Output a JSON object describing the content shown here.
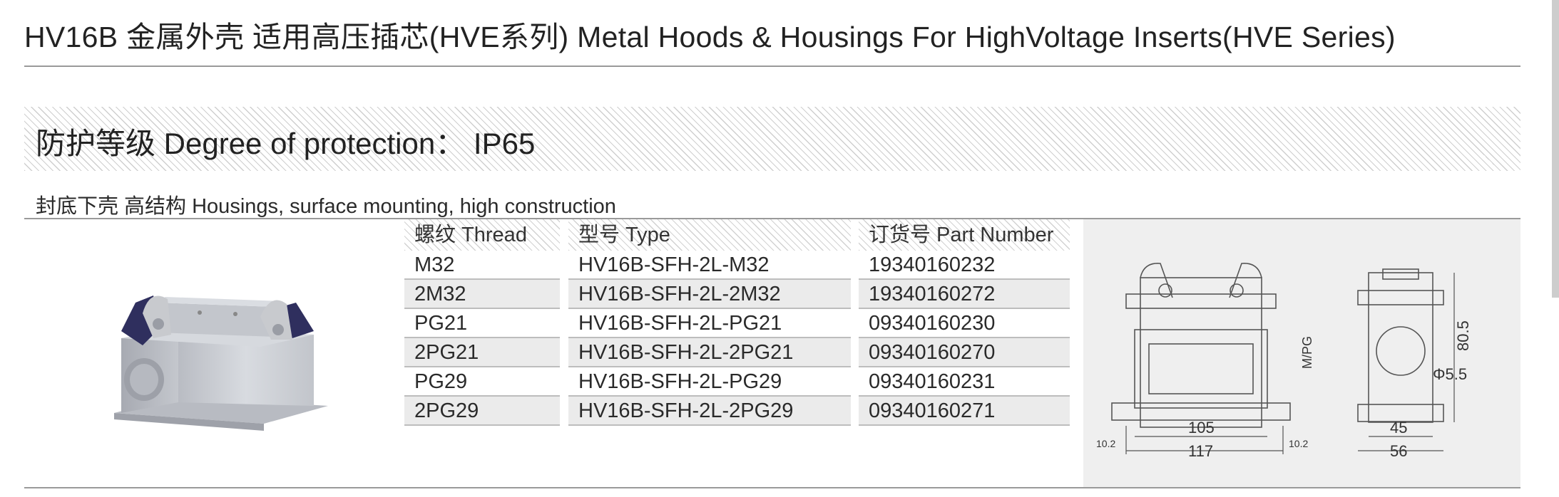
{
  "header": {
    "title": "HV16B 金属外壳  适用高压插芯(HVE系列)  Metal Hoods & Housings For HighVoltage Inserts(HVE Series)"
  },
  "protection": {
    "text": "防护等级 Degree of protection： IP65"
  },
  "section": {
    "subtitle": "封底下壳 高结构 Housings, surface mounting, high construction"
  },
  "table": {
    "columns": [
      "螺纹 Thread",
      "型号 Type",
      "订货号 Part Number"
    ],
    "rows": [
      {
        "thread": "M32",
        "type": "HV16B-SFH-2L-M32",
        "part_number": "19340160232"
      },
      {
        "thread": "2M32",
        "type": "HV16B-SFH-2L-2M32",
        "part_number": "19340160272"
      },
      {
        "thread": "PG21",
        "type": "HV16B-SFH-2L-PG21",
        "part_number": "09340160230"
      },
      {
        "thread": "2PG21",
        "type": "HV16B-SFH-2L-2PG21",
        "part_number": "09340160270"
      },
      {
        "thread": "PG29",
        "type": "HV16B-SFH-2L-PG29",
        "part_number": "09340160231"
      },
      {
        "thread": "2PG29",
        "type": "HV16B-SFH-2L-2PG29",
        "part_number": "09340160271"
      }
    ]
  },
  "drawing": {
    "front": {
      "dim_inner": "105",
      "dim_outer": "117",
      "edge_left": "10.2",
      "edge_right": "10.2",
      "thread_label": "M/PG"
    },
    "side": {
      "dim_inner": "45",
      "dim_outer": "56",
      "height": "80.5",
      "hole": "Φ5.5"
    }
  },
  "colors": {
    "housing": "#c9ccd2",
    "levers": "#2f2f5e",
    "hatch": "#cfcfcf",
    "panel": "#efefef"
  }
}
